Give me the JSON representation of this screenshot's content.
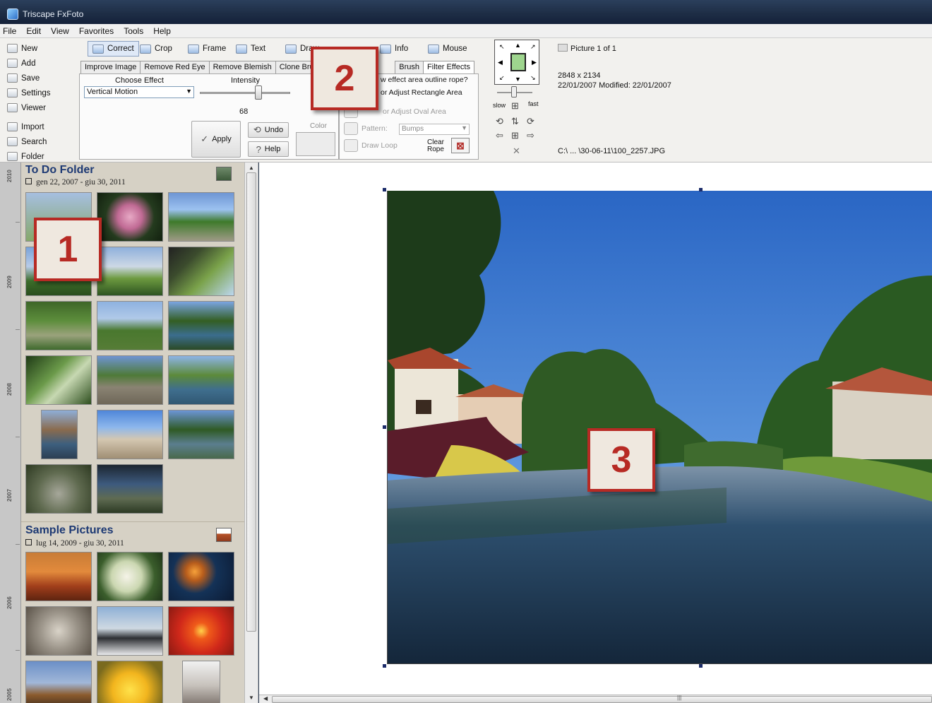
{
  "window": {
    "title": "Triscape FxFoto"
  },
  "menu": [
    "File",
    "Edit",
    "View",
    "Favorites",
    "Tools",
    "Help"
  ],
  "left_commands": [
    "New",
    "Add",
    "Save",
    "Settings",
    "Viewer",
    "Import",
    "Search",
    "Folder"
  ],
  "mode_tabs": [
    "Correct",
    "Crop",
    "Frame",
    "Text",
    "Draw",
    "Info",
    "Mouse"
  ],
  "sub_tabs": [
    "Improve Image",
    "Remove Red Eye",
    "Remove Blemish",
    "Clone Brush",
    "Brush",
    "Filter Effects"
  ],
  "correct_panel": {
    "choose_effect_label": "Choose Effect",
    "effect_value": "Vertical Motion",
    "intensity_label": "Intensity",
    "intensity_value": "68",
    "intensity_fraction": 0.68,
    "apply": "Apply",
    "undo": "Undo",
    "help": "Help",
    "color_label": "Color"
  },
  "filter_panel": {
    "outline_question": "w effect area outline rope?",
    "rect_area": "or Adjust Rectangle Area",
    "oval_area": "or Adjust Oval Area",
    "pattern_label": "Pattern:",
    "pattern_value": "Bumps",
    "draw_loop": "Draw Loop",
    "clear_rope_1": "Clear",
    "clear_rope_2": "Rope"
  },
  "nav_control": {
    "slow": "slow",
    "fast": "fast"
  },
  "picture_info": {
    "picture_of": "Picture 1 of 1",
    "dimensions": "2848 x 2134",
    "dates": "22/01/2007  Modified: 22/01/2007",
    "path": "C:\\ ... \\30-06-11\\100_2257.JPG"
  },
  "callouts": [
    "1",
    "2",
    "3"
  ],
  "timeline_years": [
    "2010",
    "2009",
    "2008",
    "2007",
    "2006",
    "2005"
  ],
  "folders": [
    {
      "title": "To Do Folder",
      "range": "gen 22, 2007 - giu 30, 2011"
    },
    {
      "title": "Sample Pictures",
      "range": "lug 14, 2009 - giu 30, 2011"
    }
  ],
  "colors": {
    "callout_red": "#b72a24",
    "folder_title_blue": "#1e3a74",
    "browser_bg": "#d6d1c5",
    "titlebar": "#1e2e46"
  }
}
